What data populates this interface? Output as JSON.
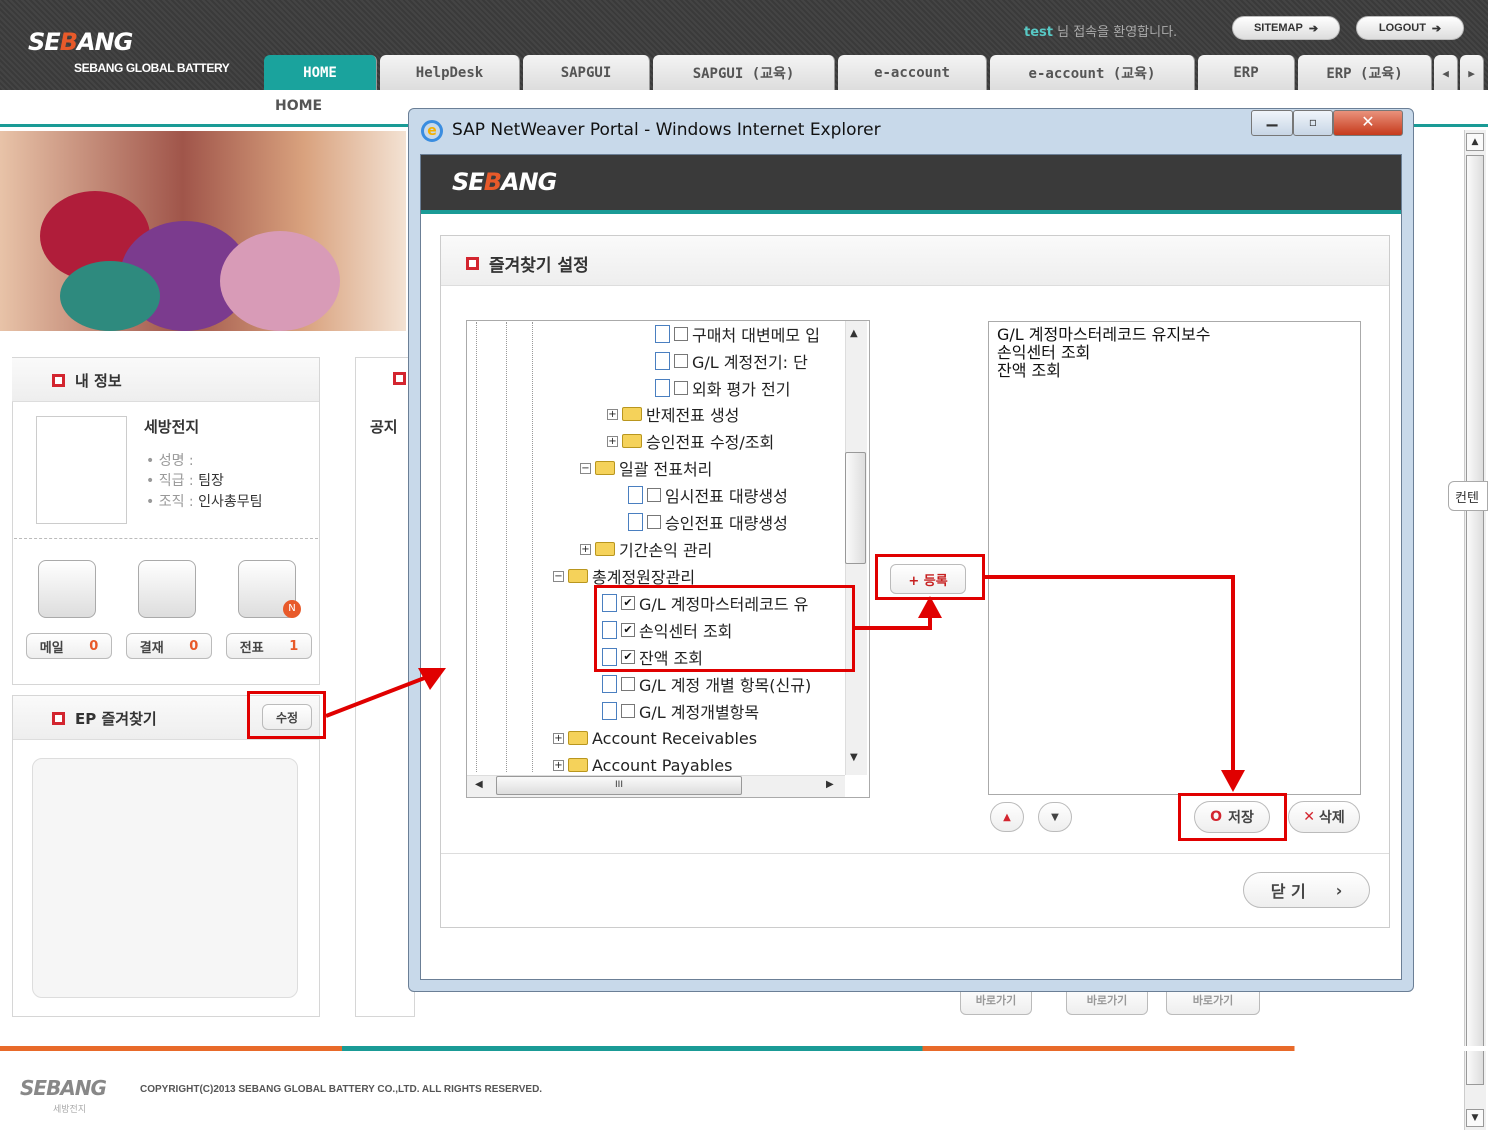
{
  "header": {
    "logo_main": "SE",
    "logo_mid": "B",
    "logo_end": "ANG",
    "logo_sub": "SEBANG GLOBAL BATTERY",
    "welcome_user": "test",
    "welcome_text": "님 접속을 환영합니다.",
    "sitemap": "SITEMAP",
    "logout": "LOGOUT",
    "tabs": [
      "HOME",
      "HelpDesk",
      "SAPGUI",
      "SAPGUI (교육)",
      "e-account",
      "e-account (교육)",
      "ERP",
      "ERP (교육)"
    ],
    "breadcrumb": "HOME"
  },
  "myinfo": {
    "title": "내 정보",
    "company": "세방전지",
    "name_label": "• 성명 :",
    "rank_label": "• 직급 :",
    "rank_value": "팀장",
    "org_label": "• 조직 :",
    "org_value": "인사총무팀",
    "counters": [
      {
        "label": "메일",
        "count": "0"
      },
      {
        "label": "결재",
        "count": "0"
      },
      {
        "label": "전표",
        "count": "1"
      }
    ],
    "badge": "N"
  },
  "notice": {
    "label": "공지"
  },
  "ep_fav": {
    "title": "EP 즐겨찾기",
    "edit": "수정"
  },
  "side_tab": "컨텐",
  "popup": {
    "window_title": "SAP NetWeaver Portal - Windows Internet Explorer",
    "section_title": "즐겨찾기 설정",
    "tree": [
      "구매처 대변메모 입",
      "G/L 계정전기: 단",
      "외화 평가 전기",
      "반제전표 생성",
      "승인전표 수정/조회",
      "일괄 전표처리",
      "임시전표 대량생성",
      "승인전표 대량생성",
      "기간손익 관리",
      "총계정원장관리",
      "G/L 계정마스터레코드 유",
      "손익센터 조회",
      "잔액 조회",
      "G/L 계정 개별 항목(신규)",
      "G/L 계정개별항목",
      "Account Receivables",
      "Account Payables"
    ],
    "register": "+ 등록",
    "selected": [
      "G/L 계정마스터레코드 유지보수",
      "손익센터 조회",
      "잔액 조회"
    ],
    "save": "저장",
    "delete": "삭제",
    "close": "닫 기",
    "scroll_mark": "III"
  },
  "behind": {
    "goto": "바로가기"
  },
  "footer": {
    "logo": "SEBANG",
    "logo_sub": "세방전지",
    "copyright": "COPYRIGHT(C)2013 SEBANG GLOBAL BATTERY CO.,LTD. ALL RIGHTS RESERVED."
  }
}
